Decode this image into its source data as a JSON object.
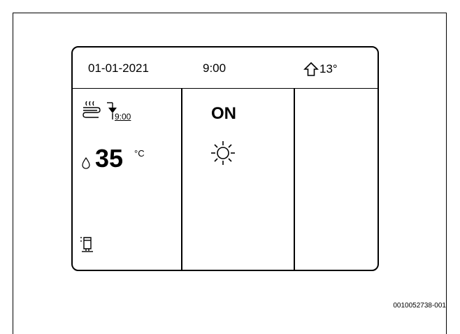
{
  "display": {
    "date": "01-01-2021",
    "time": "9:00",
    "outdoor_temp": "13°"
  },
  "heating_panel": {
    "timer_label": "9:00",
    "water_temp_value": "35",
    "water_temp_unit": "°C"
  },
  "status_panel": {
    "status": "ON",
    "mode_icon": "sun-icon"
  },
  "document_id": "0010052738-001"
}
